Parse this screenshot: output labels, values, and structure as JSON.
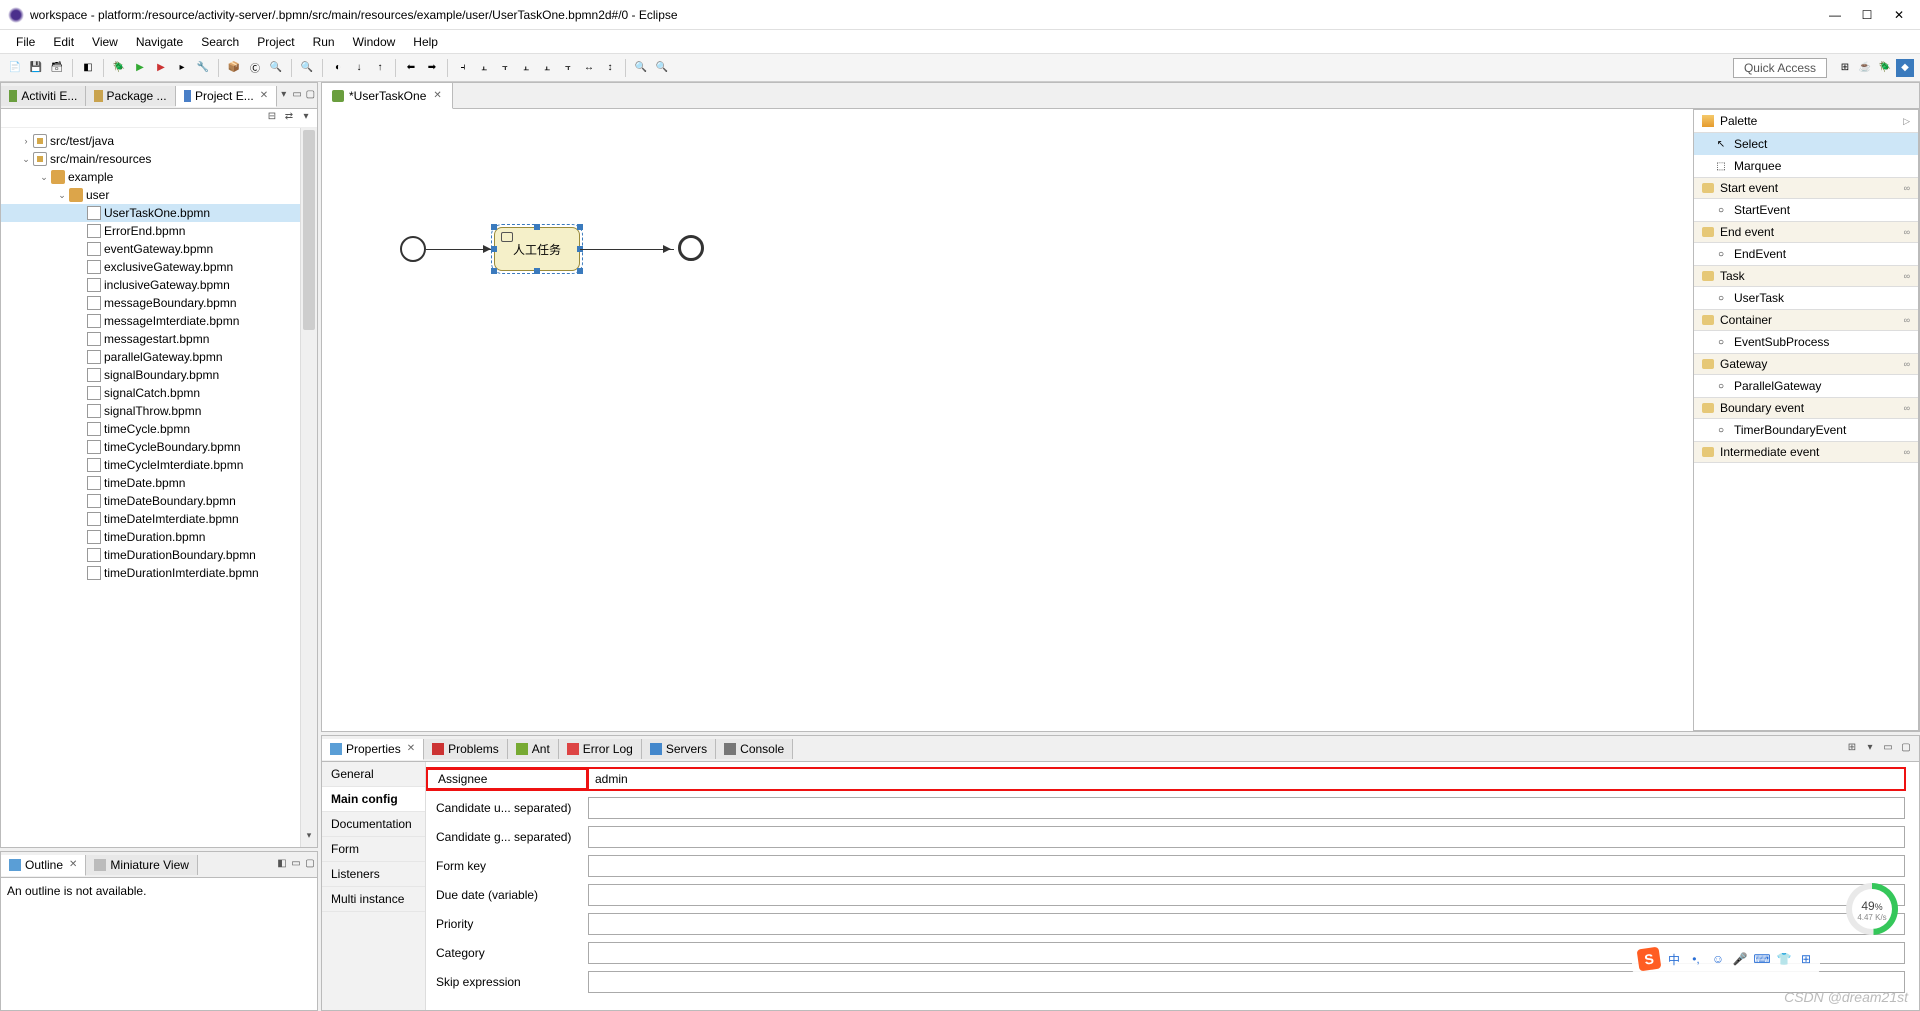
{
  "window": {
    "title": "workspace - platform:/resource/activity-server/.bpmn/src/main/resources/example/user/UserTaskOne.bpmn2d#/0 - Eclipse"
  },
  "menu": [
    "File",
    "Edit",
    "View",
    "Navigate",
    "Search",
    "Project",
    "Run",
    "Window",
    "Help"
  ],
  "quick_access": "Quick Access",
  "left_views": {
    "tabs": [
      {
        "label": "Activiti E..."
      },
      {
        "label": "Package ..."
      },
      {
        "label": "Project E...",
        "active": true
      }
    ]
  },
  "tree": [
    {
      "d": 0,
      "t": "twisty-closed",
      "icon": "pkg",
      "label": "src/test/java"
    },
    {
      "d": 0,
      "t": "twisty-open",
      "icon": "pkg",
      "label": "src/main/resources"
    },
    {
      "d": 1,
      "t": "twisty-open",
      "icon": "folder",
      "label": "example"
    },
    {
      "d": 2,
      "t": "twisty-open",
      "icon": "folder",
      "label": "user"
    },
    {
      "d": 3,
      "icon": "file",
      "label": "UserTaskOne.bpmn",
      "selected": true
    },
    {
      "d": 3,
      "icon": "file",
      "label": "ErrorEnd.bpmn"
    },
    {
      "d": 3,
      "icon": "file",
      "label": "eventGateway.bpmn"
    },
    {
      "d": 3,
      "icon": "file",
      "label": "exclusiveGateway.bpmn"
    },
    {
      "d": 3,
      "icon": "file",
      "label": "inclusiveGateway.bpmn"
    },
    {
      "d": 3,
      "icon": "file",
      "label": "messageBoundary.bpmn"
    },
    {
      "d": 3,
      "icon": "file",
      "label": "messageImterdiate.bpmn"
    },
    {
      "d": 3,
      "icon": "file",
      "label": "messagestart.bpmn"
    },
    {
      "d": 3,
      "icon": "file",
      "label": "parallelGateway.bpmn"
    },
    {
      "d": 3,
      "icon": "file",
      "label": "signalBoundary.bpmn"
    },
    {
      "d": 3,
      "icon": "file",
      "label": "signalCatch.bpmn"
    },
    {
      "d": 3,
      "icon": "file",
      "label": "signalThrow.bpmn"
    },
    {
      "d": 3,
      "icon": "file",
      "label": "timeCycle.bpmn"
    },
    {
      "d": 3,
      "icon": "file",
      "label": "timeCycleBoundary.bpmn"
    },
    {
      "d": 3,
      "icon": "file",
      "label": "timeCycleImterdiate.bpmn"
    },
    {
      "d": 3,
      "icon": "file",
      "label": "timeDate.bpmn"
    },
    {
      "d": 3,
      "icon": "file",
      "label": "timeDateBoundary.bpmn"
    },
    {
      "d": 3,
      "icon": "file",
      "label": "timeDateImterdiate.bpmn"
    },
    {
      "d": 3,
      "icon": "file",
      "label": "timeDuration.bpmn"
    },
    {
      "d": 3,
      "icon": "file",
      "label": "timeDurationBoundary.bpmn"
    },
    {
      "d": 3,
      "icon": "file",
      "label": "timeDurationImterdiate.bpmn"
    }
  ],
  "outline": {
    "tab_outline": "Outline",
    "tab_miniature": "Miniature View",
    "empty": "An outline is not available."
  },
  "editor": {
    "tab": "*UserTaskOne",
    "task_label": "人工任务"
  },
  "palette": {
    "title": "Palette",
    "tools": [
      "Select",
      "Marquee"
    ],
    "drawers": [
      {
        "name": "Start event",
        "items": [
          "StartEvent"
        ]
      },
      {
        "name": "End event",
        "items": [
          "EndEvent"
        ]
      },
      {
        "name": "Task",
        "items": [
          "UserTask"
        ]
      },
      {
        "name": "Container",
        "items": [
          "EventSubProcess"
        ]
      },
      {
        "name": "Gateway",
        "items": [
          "ParallelGateway"
        ]
      },
      {
        "name": "Boundary event",
        "items": [
          "TimerBoundaryEvent"
        ]
      },
      {
        "name": "Intermediate event",
        "items": []
      }
    ]
  },
  "bottom": {
    "tabs": [
      "Properties",
      "Problems",
      "Ant",
      "Error Log",
      "Servers",
      "Console"
    ],
    "prop_tabs": [
      "General",
      "Main config",
      "Documentation",
      "Form",
      "Listeners",
      "Multi instance"
    ],
    "active_prop_tab": "Main config",
    "fields": [
      {
        "label": "Assignee",
        "value": "admin",
        "highlight": true
      },
      {
        "label": "Candidate u... separated)",
        "value": ""
      },
      {
        "label": "Candidate g... separated)",
        "value": ""
      },
      {
        "label": "Form key",
        "value": ""
      },
      {
        "label": "Due date (variable)",
        "value": ""
      },
      {
        "label": "Priority",
        "value": ""
      },
      {
        "label": "Category",
        "value": ""
      },
      {
        "label": "Skip expression",
        "value": ""
      }
    ]
  },
  "ime": {
    "logo": "S",
    "lang": "中"
  },
  "gauge": {
    "value": "49",
    "unit": "%",
    "rate": "4.47 K/s"
  },
  "watermark": "CSDN @dream21st"
}
